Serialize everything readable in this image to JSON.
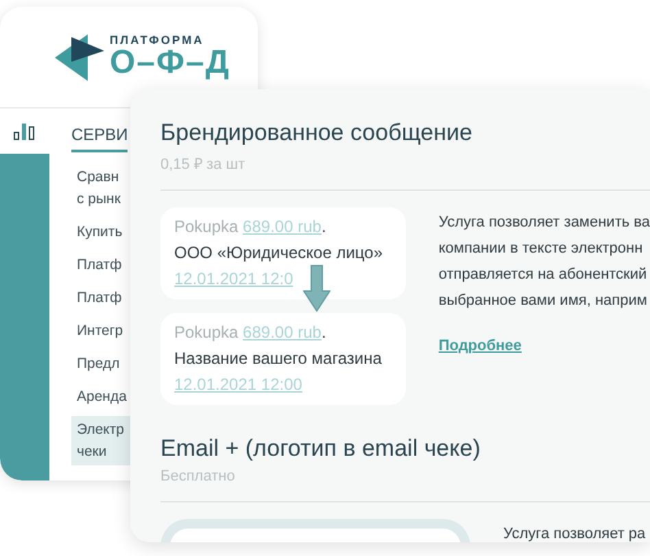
{
  "sidebar_window": {
    "logo": {
      "top": "ПЛАТФОРМА",
      "bottom": "О–Ф–Д"
    },
    "tab": {
      "label": "СЕРВИ",
      "selected": true
    },
    "items": [
      {
        "lines": [
          "Сравн",
          "с рынк"
        ],
        "selected": false
      },
      {
        "lines": [
          "Купить"
        ],
        "selected": false
      },
      {
        "lines": [
          "Платф"
        ],
        "selected": false
      },
      {
        "lines": [
          "Платф"
        ],
        "selected": false
      },
      {
        "lines": [
          "Интегр"
        ],
        "selected": false
      },
      {
        "lines": [
          "Предл"
        ],
        "selected": false
      },
      {
        "lines": [
          "Аренда"
        ],
        "selected": false
      },
      {
        "lines": [
          "Электр",
          "чеки"
        ],
        "selected": true
      }
    ]
  },
  "services": [
    {
      "kind": "sms",
      "title": "Брендированное сообщение",
      "price": "0,15 ₽ за шт",
      "messages": [
        {
          "label": "Pokupka",
          "amount": "689.00 rub",
          "end": ".",
          "name": "ООО «Юридическое лицо»",
          "date": "12.01.2021 12:0"
        },
        {
          "label": "Pokupka",
          "amount": "689.00 rub",
          "end": ".",
          "name": "Название вашего магазина",
          "date": "12.01.2021 12:00"
        }
      ],
      "description": [
        "Услуга позволяет заменить ва",
        "компании в тексте электронн",
        "отправляется на абонентский",
        "выбранное вами имя, наприм"
      ],
      "link": "Подробнее"
    },
    {
      "kind": "email",
      "title": "Email + (логотип в email чеке)",
      "price": "Бесплатно",
      "description": [
        "Услуга позволяет ра"
      ]
    }
  ]
}
